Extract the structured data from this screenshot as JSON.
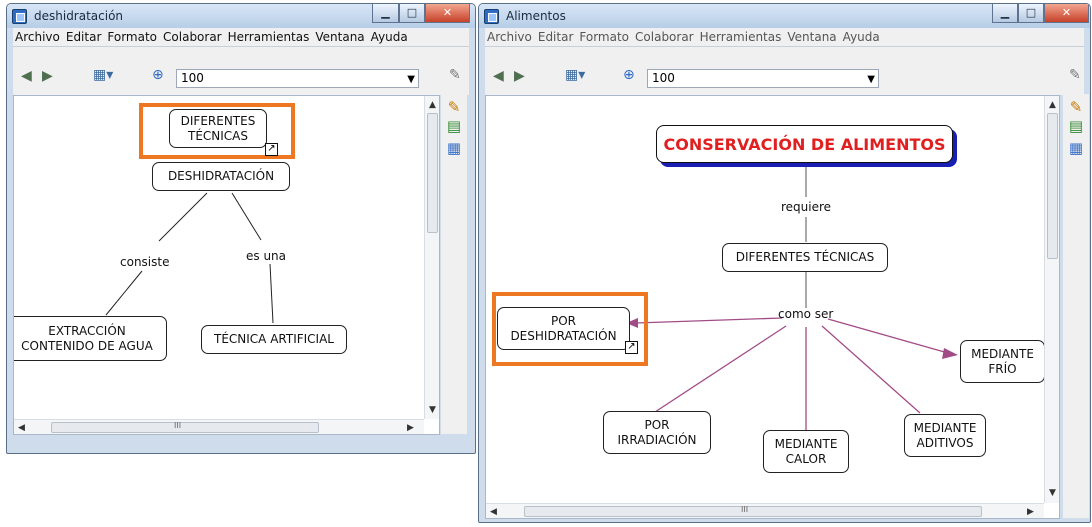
{
  "windows": {
    "left": {
      "title": "deshidratación",
      "menu": [
        "Archivo",
        "Editar",
        "Formato",
        "Colaborar",
        "Herramientas",
        "Ventana",
        "Ayuda"
      ],
      "zoom": "100",
      "nodes": {
        "diferentes": "DIFERENTES\nTÉCNICAS",
        "deshidratacion": "DESHIDRATACIÓN",
        "extraccion": "EXTRACCIÓN\nCONTENIDO DE AGUA",
        "tecnica": "TÉCNICA ARTIFICIAL"
      },
      "links": {
        "consiste": "consiste",
        "esuna": "es una"
      },
      "scroll_mark": "III"
    },
    "right": {
      "title": "Alimentos",
      "menu": [
        "Archivo",
        "Editar",
        "Formato",
        "Colaborar",
        "Herramientas",
        "Ventana",
        "Ayuda"
      ],
      "zoom": "100",
      "nodes": {
        "conservacion": "CONSERVACIÓN DE ALIMENTOS",
        "diferentes": "DIFERENTES TÉCNICAS",
        "deshidratacion": "POR\nDESHIDRATACIÓN",
        "frio": "MEDIANTE\nFRÍO",
        "irradiacion": "POR\nIRRADIACIÓN",
        "calor": "MEDIANTE\nCALOR",
        "aditivos": "MEDIANTE\nADITIVOS"
      },
      "links": {
        "requiere": "requiere",
        "comoser": "como ser"
      },
      "scroll_mark": "III"
    }
  },
  "colors": {
    "highlight": "#ee7722",
    "title_shadow": "#1a1fb4",
    "title_text": "#e02020",
    "connector_purple": "#a24c87"
  },
  "icons": {
    "app": "cmap-app-icon",
    "back": "back-arrow-icon",
    "forward": "forward-arrow-icon",
    "view": "view-icon",
    "zoom": "zoom-icon",
    "link": "shortcut-link-icon",
    "edit_tools": "pen-icon"
  }
}
